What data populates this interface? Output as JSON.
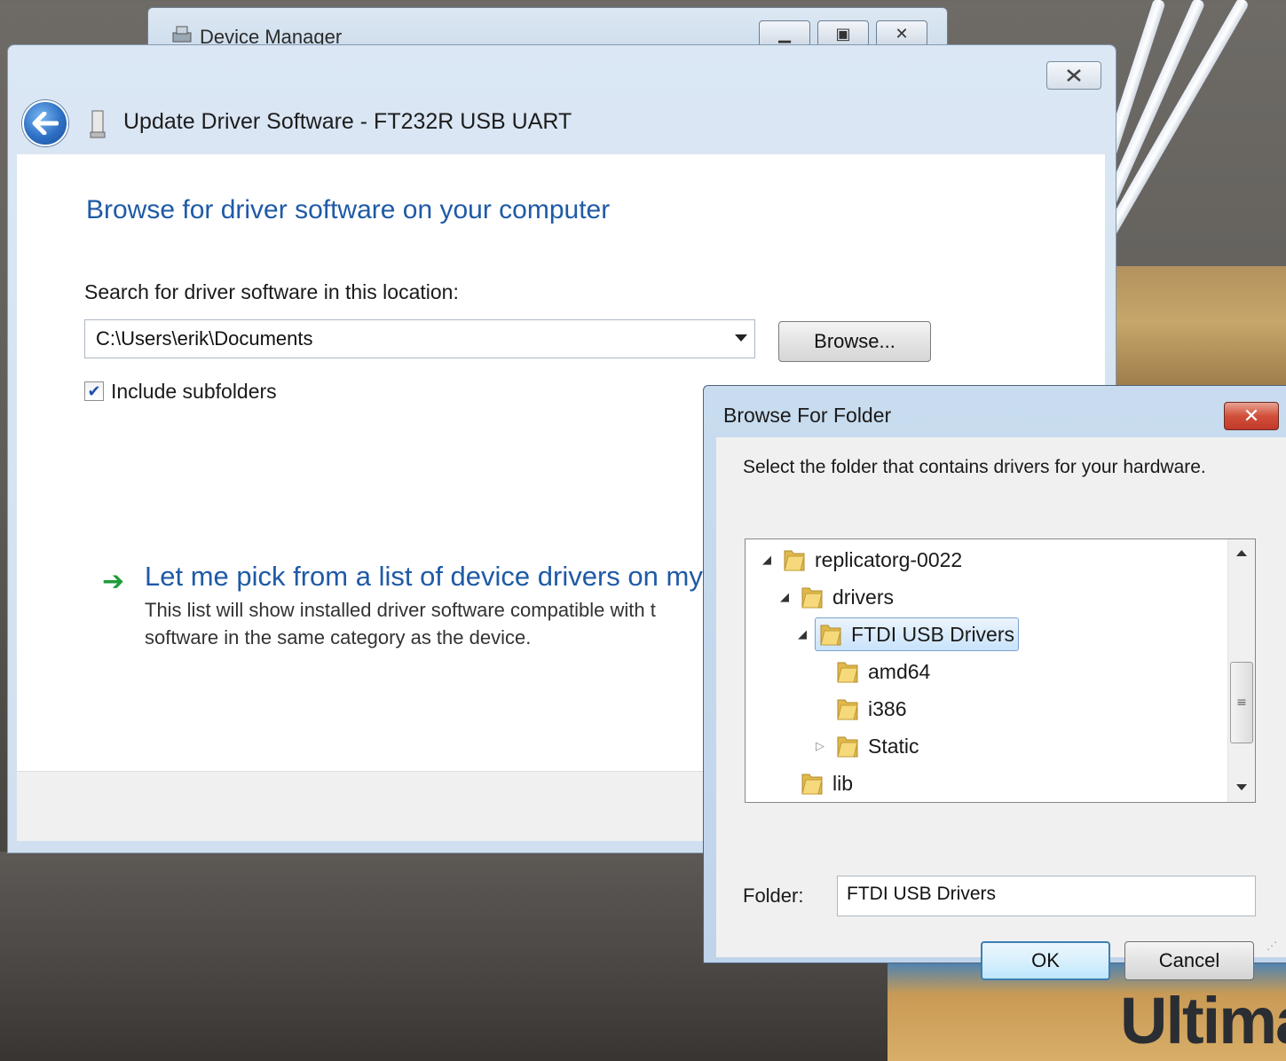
{
  "background": {
    "brand_text": "Ultima"
  },
  "device_manager": {
    "title": "Device Manager"
  },
  "wizard": {
    "title": "Update Driver Software - FT232R USB UART",
    "heading": "Browse for driver software on your computer",
    "search_label": "Search for driver software in this location:",
    "path_value": "C:\\Users\\erik\\Documents",
    "browse_label": "Browse...",
    "include_subfolders_label": "Include subfolders",
    "include_subfolders_checked": true,
    "pick_link": "Let me pick from a list of device drivers on my",
    "pick_desc_line1": "This list will show installed driver software compatible with t",
    "pick_desc_line2": "software in the same category as the device."
  },
  "browse_folder": {
    "title": "Browse For Folder",
    "instruction": "Select the folder that contains drivers for your hardware.",
    "tree": [
      {
        "label": "replicatorg-0022",
        "level": 0,
        "expander": "expanded",
        "selected": false
      },
      {
        "label": "drivers",
        "level": 1,
        "expander": "expanded",
        "selected": false
      },
      {
        "label": "FTDI USB Drivers",
        "level": 2,
        "expander": "expanded",
        "selected": true
      },
      {
        "label": "amd64",
        "level": 3,
        "expander": "none",
        "selected": false
      },
      {
        "label": "i386",
        "level": 3,
        "expander": "none",
        "selected": false
      },
      {
        "label": "Static",
        "level": 3,
        "expander": "collapsed",
        "selected": false
      },
      {
        "label": "lib",
        "level": 1,
        "expander": "none",
        "selected": false
      }
    ],
    "folder_label": "Folder:",
    "folder_value": "FTDI USB Drivers",
    "ok_label": "OK",
    "cancel_label": "Cancel"
  },
  "colors": {
    "link_blue": "#1f5aa6",
    "arrow_green": "#1f9c3a",
    "close_red": "#c0392a",
    "selection_border": "#7da2ce"
  }
}
